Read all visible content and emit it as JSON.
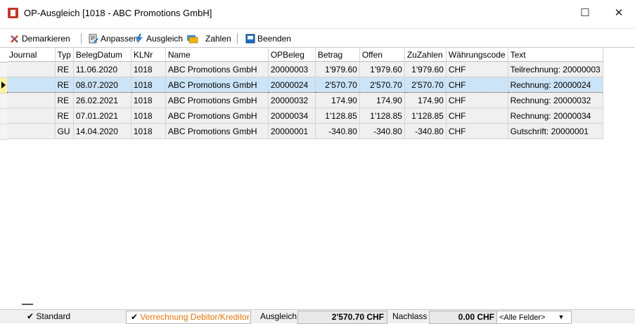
{
  "window": {
    "title": "OP-Ausgleich [1018 - ABC Promotions GmbH]",
    "maximize_glyph": "☐",
    "close_glyph": "✕"
  },
  "toolbar": {
    "demarkieren": "Demarkieren",
    "anpassen": "Anpassen",
    "ausgleich": "Ausgleich",
    "zahlen": "Zahlen",
    "beenden": "Beenden"
  },
  "grid": {
    "columns": [
      "Journal",
      "Typ",
      "BelegDatum",
      "KLNr",
      "Name",
      "OPBeleg",
      "Betrag",
      "Offen",
      "ZuZahlen",
      "Währungscode",
      "Text"
    ],
    "rows": [
      {
        "journal": "",
        "typ": "RE",
        "datum": "11.06.2020",
        "klnr": "1018",
        "name": "ABC Promotions GmbH",
        "opbeleg": "20000003",
        "betrag": "1'979.60",
        "offen": "1'979.60",
        "zuzahlen": "1'979.60",
        "waehrung": "CHF",
        "text": "Teilrechnung: 20000003"
      },
      {
        "journal": "",
        "typ": "RE",
        "datum": "08.07.2020",
        "klnr": "1018",
        "name": "ABC Promotions GmbH",
        "opbeleg": "20000024",
        "betrag": "2'570.70",
        "offen": "2'570.70",
        "zuzahlen": "2'570.70",
        "waehrung": "CHF",
        "text": "Rechnung: 20000024"
      },
      {
        "journal": "",
        "typ": "RE",
        "datum": "26.02.2021",
        "klnr": "1018",
        "name": "ABC Promotions GmbH",
        "opbeleg": "20000032",
        "betrag": "174.90",
        "offen": "174.90",
        "zuzahlen": "174.90",
        "waehrung": "CHF",
        "text": "Rechnung: 20000032"
      },
      {
        "journal": "",
        "typ": "RE",
        "datum": "07.01.2021",
        "klnr": "1018",
        "name": "ABC Promotions GmbH",
        "opbeleg": "20000034",
        "betrag": "1'128.85",
        "offen": "1'128.85",
        "zuzahlen": "1'128.85",
        "waehrung": "CHF",
        "text": "Rechnung: 20000034"
      },
      {
        "journal": "",
        "typ": "GU",
        "datum": "14.04.2020",
        "klnr": "1018",
        "name": "ABC Promotions GmbH",
        "opbeleg": "20000001",
        "betrag": "-340.80",
        "offen": "-340.80",
        "zuzahlen": "-340.80",
        "waehrung": "CHF",
        "text": "Gutschrift: 20000001"
      }
    ],
    "selected_row": 1
  },
  "status": {
    "standard": "Standard",
    "verrechnung": "Verrechnung Debitor/Kreditor",
    "ausgleich_label": "Ausgleich",
    "ausgleich_value": "2'570.70 CHF",
    "nachlass_label": "Nachlass",
    "nachlass_value": "0.00 CHF",
    "filter_value": "<Alle Felder>",
    "check_glyph": "✔"
  },
  "colors": {
    "selected_row": "#cce4f7",
    "verrechnung_text": "#e8740c",
    "row_bg": "#f0f0f0"
  }
}
